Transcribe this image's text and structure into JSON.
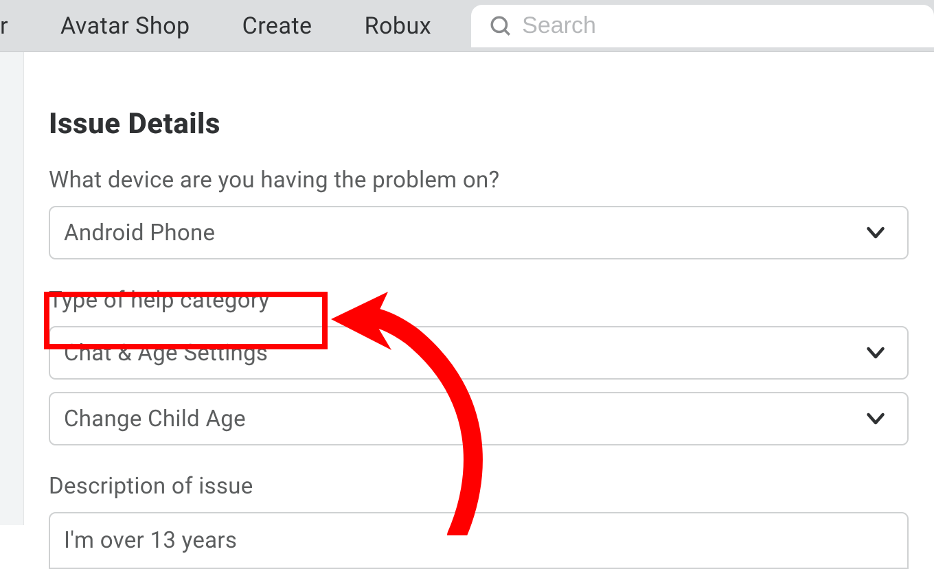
{
  "nav": {
    "partial": "r",
    "items": [
      "Avatar Shop",
      "Create",
      "Robux"
    ]
  },
  "search": {
    "placeholder": "Search"
  },
  "form": {
    "title": "Issue Details",
    "device_label": "What device are you having the problem on?",
    "device_value": "Android Phone",
    "category_label": "Type of help category",
    "category_value": "Chat & Age Settings",
    "subcategory_value": "Change Child Age",
    "description_label": "Description of issue",
    "description_value": "I'm over 13 years"
  }
}
